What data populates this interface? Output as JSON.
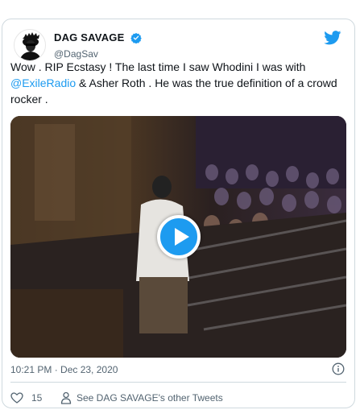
{
  "tweet": {
    "display_name": "DAG SAVAGE",
    "handle": "@DagSav",
    "text_parts": {
      "part1": "Wow . RIP Ecstasy ! The last time I saw Whodini I was with ",
      "mention": "@ExileRadio",
      "part2": " & Asher Roth . He was the true definition of a crowd rocker ."
    },
    "timestamp": "10:21 PM · Dec 23, 2020",
    "like_count": "15",
    "other_tweets_label": "See DAG SAVAGE's other Tweets"
  },
  "icons": {
    "verified": "verified-badge-icon",
    "brand": "twitter-bird-icon",
    "play": "play-icon",
    "info": "info-icon",
    "like": "heart-icon",
    "profile": "person-icon"
  },
  "colors": {
    "accent": "#1d9bf0",
    "text": "#0f1419",
    "secondary": "#536471",
    "border": "#cfd9de"
  }
}
